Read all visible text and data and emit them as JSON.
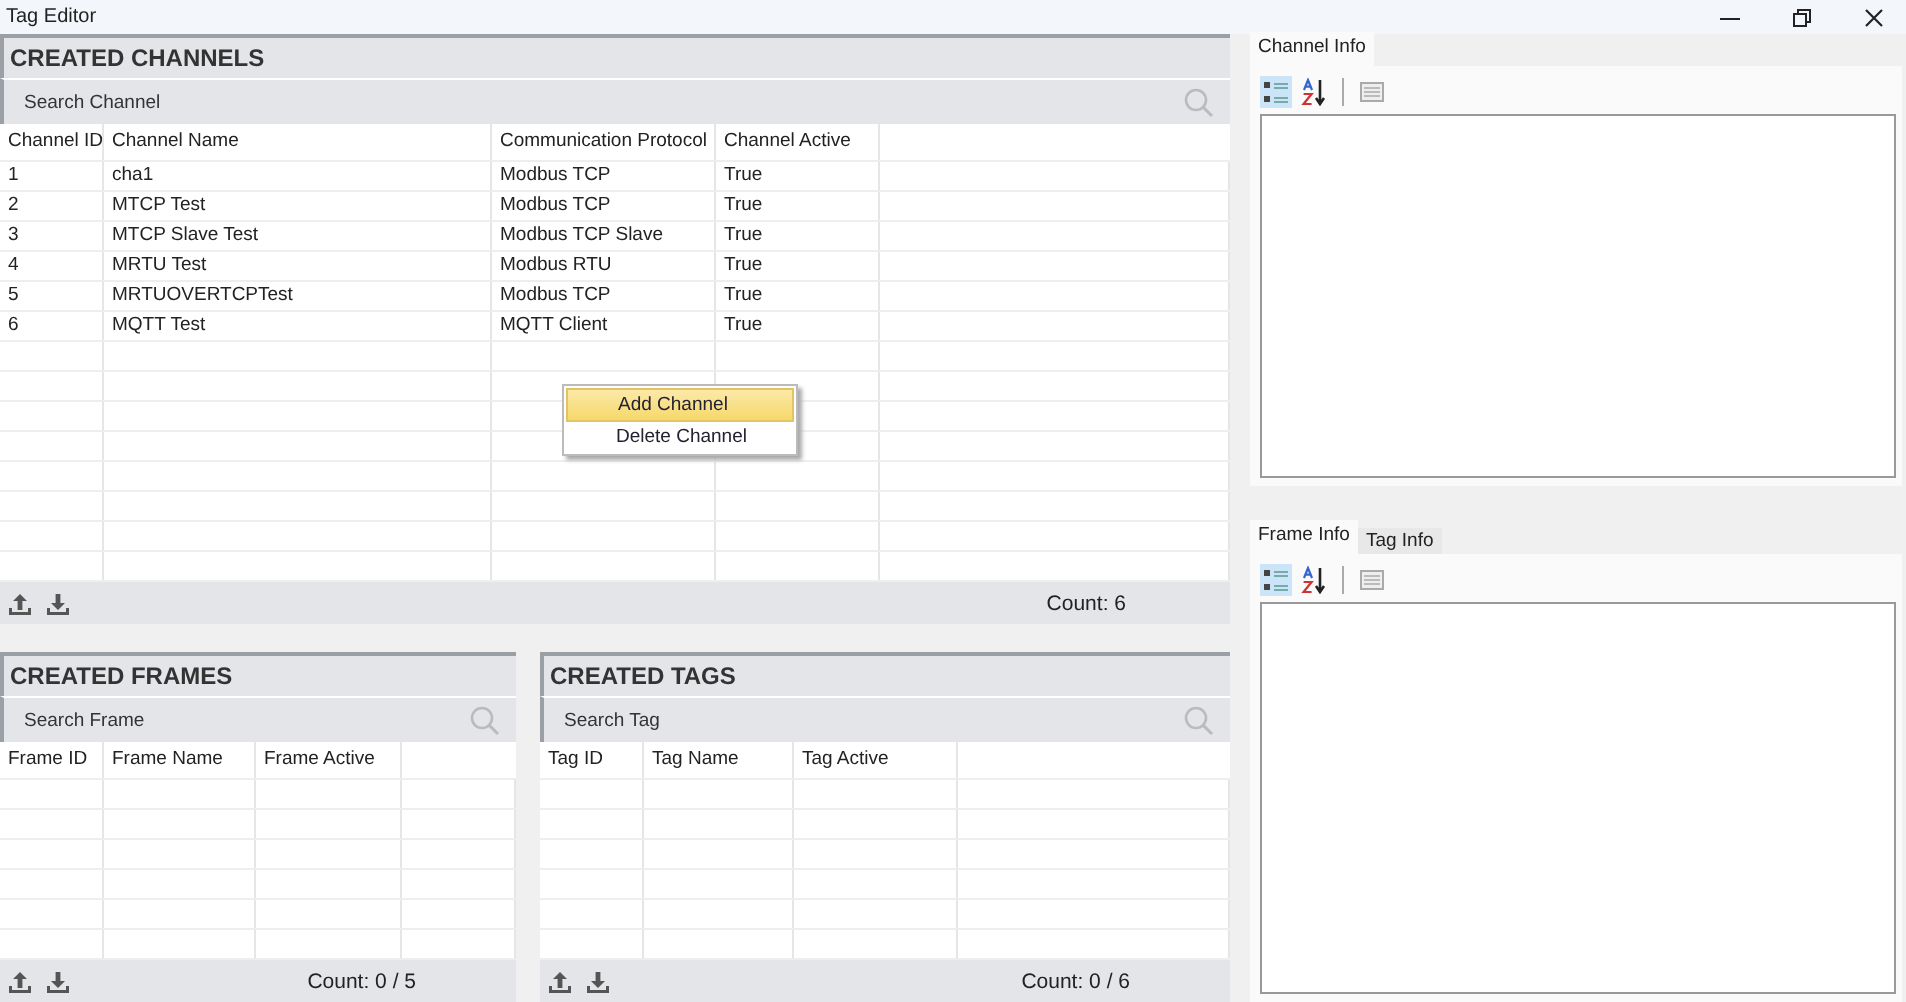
{
  "window": {
    "title": "Tag Editor"
  },
  "channels": {
    "title": "CREATED CHANNELS",
    "search": {
      "placeholder": "Search Channel"
    },
    "columns": [
      "Channel ID",
      "Channel Name",
      "Communication Protocol",
      "Channel Active"
    ],
    "rows": [
      [
        "1",
        "cha1",
        "Modbus TCP",
        "True"
      ],
      [
        "2",
        "MTCP Test",
        "Modbus TCP",
        "True"
      ],
      [
        "3",
        "MTCP Slave Test",
        "Modbus TCP Slave",
        "True"
      ],
      [
        "4",
        "MRTU Test",
        "Modbus RTU",
        "True"
      ],
      [
        "5",
        "MRTUOVERTCPTest",
        "Modbus TCP",
        "True"
      ],
      [
        "6",
        "MQTT Test",
        "MQTT Client",
        "True"
      ]
    ],
    "count": "Count: 6"
  },
  "context_menu": [
    {
      "label": "Add Channel",
      "selected": true
    },
    {
      "label": "Delete Channel",
      "selected": false
    }
  ],
  "frames": {
    "title": "CREATED FRAMES",
    "search": {
      "placeholder": "Search Frame"
    },
    "columns": [
      "Frame ID",
      "Frame Name",
      "Frame Active"
    ],
    "count": "Count: 0 / 5"
  },
  "tags": {
    "title": "CREATED TAGS",
    "search": {
      "placeholder": "Search Tag"
    },
    "columns": [
      "Tag ID",
      "Tag Name",
      "Tag Active"
    ],
    "count": "Count: 0 / 6"
  },
  "channel_info": {
    "tabs": [
      {
        "label": "Channel Info",
        "selected": true
      }
    ],
    "toolbar": [
      {
        "kind": "categorized",
        "selected": true
      },
      {
        "kind": "alphabetical",
        "selected": false
      },
      {
        "kind": "pages",
        "selected": false
      }
    ]
  },
  "frame_info": {
    "tabs": [
      {
        "label": "Frame Info",
        "selected": true
      },
      {
        "label": "Tag Info",
        "selected": false
      }
    ],
    "toolbar": [
      {
        "kind": "categorized",
        "selected": true
      },
      {
        "kind": "alphabetical",
        "selected": false
      },
      {
        "kind": "pages",
        "selected": false
      }
    ]
  }
}
